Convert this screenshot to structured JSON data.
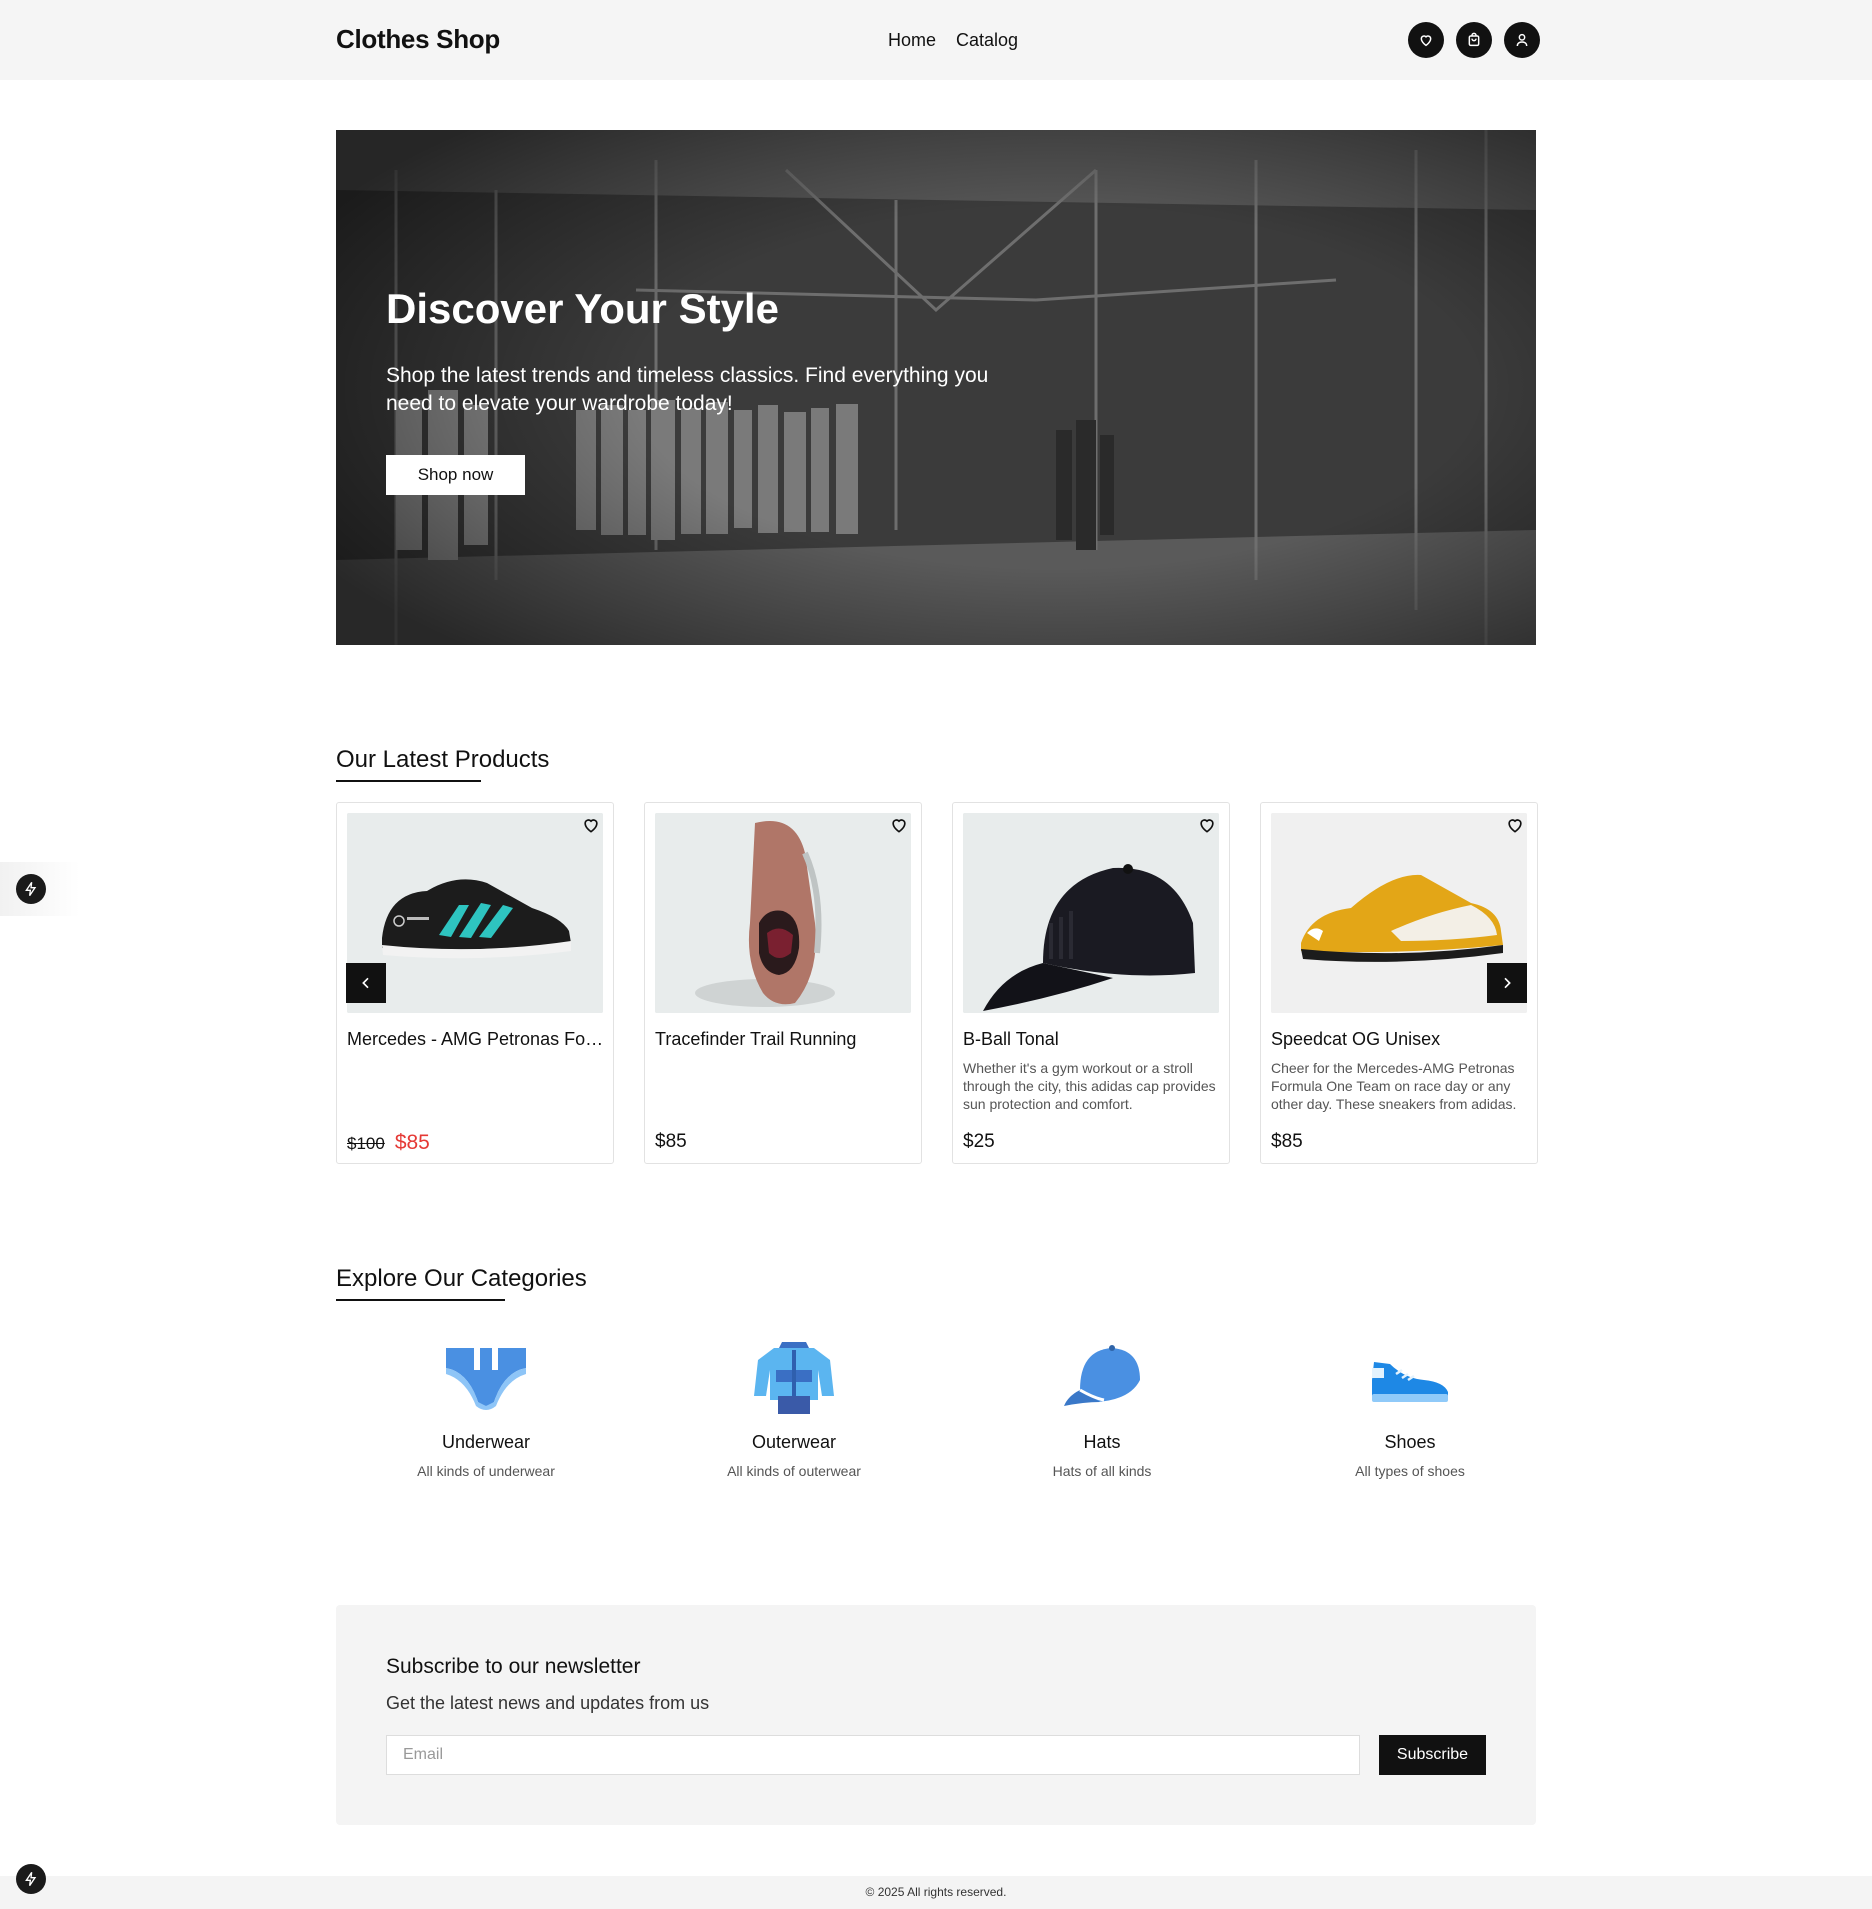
{
  "header": {
    "logo": "Clothes Shop",
    "nav": [
      "Home",
      "Catalog"
    ],
    "icons": [
      "heart-icon",
      "shopping-bag-icon",
      "user-icon"
    ]
  },
  "hero": {
    "title": "Discover Your Style",
    "text": "Shop the latest trends and timeless classics. Find everything you need to elevate your wardrobe today!",
    "button": "Shop now"
  },
  "products": {
    "title": "Our Latest Products",
    "items": [
      {
        "name": "Mercedes - AMG Petronas Formula One Team Grand Court Shoes",
        "description": "",
        "old_price": "$100",
        "price": "$85",
        "image": "black-sneaker"
      },
      {
        "name": "Tracefinder Trail Running",
        "description": "",
        "old_price": "",
        "price": "$85",
        "image": "pink-trail-shoe"
      },
      {
        "name": "B-Ball Tonal",
        "description": "Whether it's a gym workout or a stroll through the city, this adidas cap provides sun protection and comfort.",
        "old_price": "",
        "price": "$25",
        "image": "black-cap"
      },
      {
        "name": "Speedcat OG Unisex",
        "description": "Cheer for the Mercedes-AMG Petronas Formula One Team on race day or any other day. These sneakers from adidas.",
        "old_price": "",
        "price": "$85",
        "image": "yellow-sneaker"
      }
    ]
  },
  "categories": {
    "title": "Explore Our Categories",
    "items": [
      {
        "name": "Underwear",
        "description": "All kinds of underwear",
        "icon": "underwear-icon"
      },
      {
        "name": "Outerwear",
        "description": "All kinds of outerwear",
        "icon": "jacket-icon"
      },
      {
        "name": "Hats",
        "description": "Hats of all kinds",
        "icon": "hat-icon"
      },
      {
        "name": "Shoes",
        "description": "All types of shoes",
        "icon": "shoe-icon"
      }
    ]
  },
  "newsletter": {
    "title": "Subscribe to our newsletter",
    "text": "Get the latest news and updates from us",
    "placeholder": "Email",
    "button": "Subscribe"
  },
  "footer": {
    "copyright": "© 2025 All rights reserved."
  },
  "colors": {
    "accent": "#111111",
    "sale": "#e53935",
    "category_icon": "#4a90e2"
  }
}
